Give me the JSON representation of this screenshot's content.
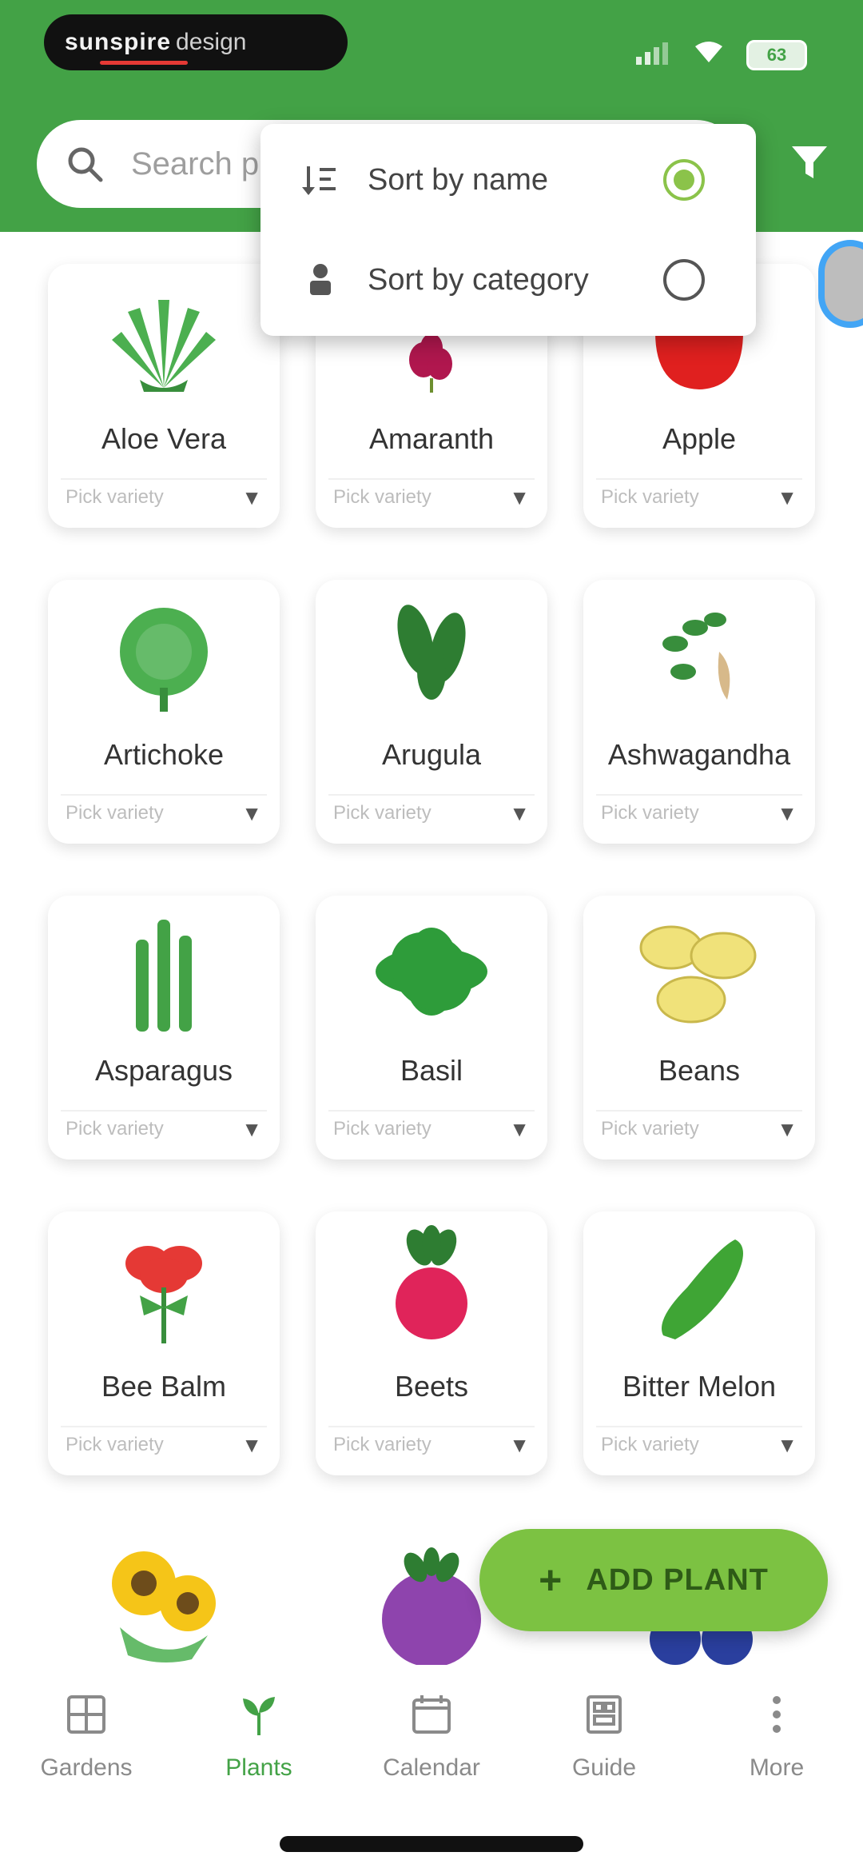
{
  "header": {
    "logo_text_bold": "sunspire",
    "logo_text_light": "design",
    "battery": "63"
  },
  "search": {
    "placeholder": "Search plants..."
  },
  "sort_menu": {
    "options": [
      {
        "label": "Sort by name",
        "selected": true
      },
      {
        "label": "Sort by category",
        "selected": false
      }
    ]
  },
  "plants": [
    {
      "name": "Aloe Vera",
      "select_placeholder": "Pick variety",
      "icon": "aloe-vera"
    },
    {
      "name": "Amaranth",
      "select_placeholder": "Pick variety",
      "icon": "amaranth"
    },
    {
      "name": "Apple",
      "select_placeholder": "Pick variety",
      "icon": "apple"
    },
    {
      "name": "Artichoke",
      "select_placeholder": "Pick variety",
      "icon": "artichoke"
    },
    {
      "name": "Arugula",
      "select_placeholder": "Pick variety",
      "icon": "arugula"
    },
    {
      "name": "Ashwagandha",
      "select_placeholder": "Pick variety",
      "icon": "ashwagandha"
    },
    {
      "name": "Asparagus",
      "select_placeholder": "Pick variety",
      "icon": "asparagus"
    },
    {
      "name": "Basil",
      "select_placeholder": "Pick variety",
      "icon": "basil"
    },
    {
      "name": "Beans",
      "select_placeholder": "Pick variety",
      "icon": "beans"
    },
    {
      "name": "Bee Balm",
      "select_placeholder": "Pick variety",
      "icon": "bee-balm"
    },
    {
      "name": "Beets",
      "select_placeholder": "Pick variety",
      "icon": "beets"
    },
    {
      "name": "Bitter Melon",
      "select_placeholder": "Pick variety",
      "icon": "bitter-melon"
    },
    {
      "name": "",
      "select_placeholder": "",
      "icon": "sunflower"
    },
    {
      "name": "",
      "select_placeholder": "",
      "icon": "blackberry"
    },
    {
      "name": "",
      "select_placeholder": "",
      "icon": "blueberry"
    }
  ],
  "fab": {
    "plus": "+",
    "label": "ADD PLANT"
  },
  "bottom_nav": [
    {
      "label": "Gardens",
      "icon": "gardens-icon",
      "active": false
    },
    {
      "label": "Plants",
      "icon": "plants-icon",
      "active": true
    },
    {
      "label": "Calendar",
      "icon": "calendar-icon",
      "active": false
    },
    {
      "label": "Guide",
      "icon": "guide-icon",
      "active": false
    },
    {
      "label": "More",
      "icon": "more-icon",
      "active": false
    }
  ],
  "colors": {
    "primary": "#43a246",
    "fab": "#7cc242",
    "radio_selected": "#8bc34a"
  }
}
